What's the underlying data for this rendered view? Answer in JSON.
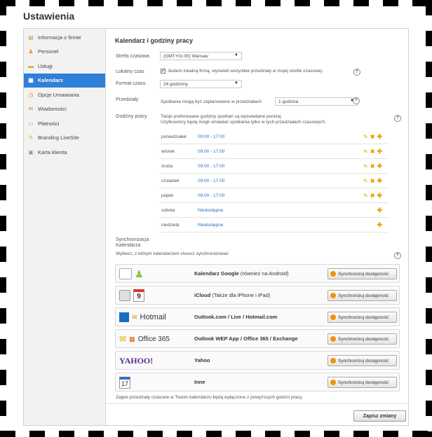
{
  "page_title": "Ustawienia",
  "sidebar": {
    "items": [
      {
        "label": "Informacja o firmie",
        "icon": "document-icon",
        "active": false
      },
      {
        "label": "Personel",
        "icon": "people-icon",
        "active": false
      },
      {
        "label": "Usługi",
        "icon": "folder-icon",
        "active": false
      },
      {
        "label": "Kalendarz",
        "icon": "calendar-icon",
        "active": true
      },
      {
        "label": "Opcje Umawiania",
        "icon": "clock-icon",
        "active": false
      },
      {
        "label": "Wiadomości",
        "icon": "envelope-icon",
        "active": false
      },
      {
        "label": "Płatności",
        "icon": "card-icon",
        "active": false
      },
      {
        "label": "Branding LiveSite",
        "icon": "brush-icon",
        "active": false
      },
      {
        "label": "Karta klienta",
        "icon": "id-card-icon",
        "active": false
      }
    ]
  },
  "main": {
    "section_title": "Kalendarz i godziny pracy",
    "timezone": {
      "label": "Strefa czasowa",
      "value": "(GMT+01:00) Warsaw"
    },
    "local_time": {
      "label": "Lokalny czas",
      "checkbox_label": "Jestem lokalną firmą, wyświetl wszystkie przedziały w mojej strefie czasowej.",
      "checked": true
    },
    "time_format": {
      "label": "Format czasu",
      "value": "24 godzinny"
    },
    "intervals": {
      "label": "Przedziały",
      "text": "Spotkania mogą być zaplanowane w przedziałach",
      "value": "1 godzina"
    },
    "working_hours": {
      "label": "Godziny pracy",
      "desc_1": "Twoje preferowane godziny spotkań są wyświetlane poniżej.",
      "desc_2": "Użytkownicy będą mogli umawiać spotkania tylko w tych przedziałach czasowych.",
      "days": [
        {
          "day": "poniedziałek",
          "time": "09:00 - 17:00",
          "available": true
        },
        {
          "day": "wtorek",
          "time": "09:00 - 17:00",
          "available": true
        },
        {
          "day": "środa",
          "time": "09:00 - 17:00",
          "available": true
        },
        {
          "day": "czwartek",
          "time": "09:00 - 17:00",
          "available": true
        },
        {
          "day": "piątek",
          "time": "09:00 - 17:00",
          "available": true
        },
        {
          "day": "sobota",
          "time": "Niedostępne",
          "available": false
        },
        {
          "day": "niedziela",
          "time": "Niedostępne",
          "available": false
        }
      ]
    },
    "sync": {
      "label_1": "Synchronizacja",
      "label_2": "Kalendarza",
      "desc": "Wybierz, z którym kalendarzem chcesz synchronizować",
      "button_label": "Synchronizuj dostępność",
      "providers": [
        {
          "bold": "Kalendarz Google",
          "rest": " (również na Android)",
          "logo_text": ""
        },
        {
          "bold": "iCloud",
          "rest": " (Także dla iPhone i iPad)",
          "logo_text": "9"
        },
        {
          "bold": "Outlook.com / Live / Hotmail.com",
          "rest": "",
          "logo_text": "Hotmail"
        },
        {
          "bold": "Outlook WEP App / Office 365 / Exchange",
          "rest": "",
          "logo_text": "Office 365"
        },
        {
          "bold": "Yahoo",
          "rest": "",
          "logo_text": "YAHOO!"
        },
        {
          "bold": "Inne",
          "rest": "",
          "logo_text": "17"
        }
      ],
      "footer_note": "Zajęte przedziały czasowe w Twoim kalendarzu będą wyłączone z powyższych godzin pracy."
    },
    "save_label": "Zapisz zmiany"
  },
  "colors": {
    "accent": "#2f80d8",
    "action": "#e8a200",
    "time_link": "#2f6fba"
  }
}
